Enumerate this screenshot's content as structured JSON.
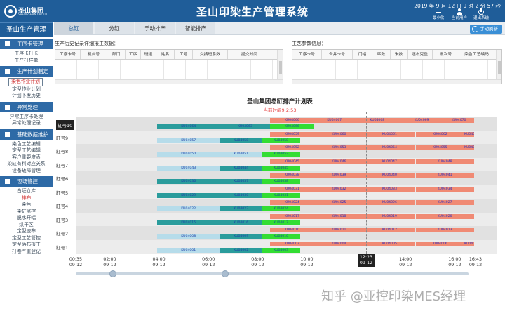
{
  "header": {
    "logo_text": "圣山集团",
    "logo_sub": "SHENGSHAN GROUP",
    "title": "圣山印染生产管理系统",
    "clock": "2019 年 9 月 12 日 9 时 2 分 57 秒",
    "buttons": [
      {
        "label": "最小化",
        "icon": "minimize-icon"
      },
      {
        "label": "当前用户",
        "icon": "user-icon"
      },
      {
        "label": "退出系统",
        "icon": "power-icon"
      }
    ]
  },
  "sidebar": {
    "title": "圣山生产管理",
    "sections": [
      {
        "label": "工序卡管理",
        "items": [
          {
            "label": "工序卡打卡"
          },
          {
            "label": "生产打样单"
          }
        ]
      },
      {
        "label": "生产计划制定",
        "items": [
          {
            "label": "染色作业计划",
            "state": "selected"
          },
          {
            "label": "定型作业计划"
          },
          {
            "label": "计划下发历史"
          }
        ]
      },
      {
        "label": "异常处理",
        "items": [
          {
            "label": "异常工序卡处理"
          },
          {
            "label": "异常处理记录"
          }
        ]
      },
      {
        "label": "基础数据维护",
        "items": [
          {
            "label": "染色工艺编辑"
          },
          {
            "label": "定型工艺编辑"
          },
          {
            "label": "客户重要度表"
          },
          {
            "label": "染缸有料对应关系"
          },
          {
            "label": "设备故障管理"
          }
        ]
      },
      {
        "label": "现场管控",
        "items": [
          {
            "label": "白坯仓库"
          },
          {
            "label": "排布",
            "state": "active"
          },
          {
            "label": "染色"
          },
          {
            "label": "染缸监控"
          },
          {
            "label": "脱水开幅"
          },
          {
            "label": "烘干区"
          },
          {
            "label": "定型速布"
          },
          {
            "label": "定型工艺管控"
          },
          {
            "label": "定型落布报工"
          },
          {
            "label": "打卷严重登记"
          }
        ]
      }
    ]
  },
  "tabs": {
    "items": [
      {
        "label": "总缸",
        "active": true
      },
      {
        "label": "分缸"
      },
      {
        "label": "手动排产"
      },
      {
        "label": "智能排产"
      }
    ],
    "refresh_label": "手动刷新"
  },
  "history_panel": {
    "label": "生产历史记录详细报工数据：",
    "columns": [
      "工序卡号",
      "机台号",
      "部门",
      "工序",
      "班组",
      "姓名",
      "工号",
      "交接班系数",
      "提交时间"
    ]
  },
  "process_panel": {
    "label": "工艺参数信息：",
    "columns": [
      "工序卡号",
      "合并卡号",
      "门幅",
      "匹数",
      "米数",
      "坯布克重",
      "批次号",
      "染色工艺编码"
    ]
  },
  "gantt": {
    "title": "圣山集团总缸排产计划表",
    "current_time": "当前时间9:2:53",
    "now_label": [
      "12:23",
      "09-12"
    ],
    "axis": [
      {
        "time": "00:35",
        "date": "09-12"
      },
      {
        "time": "02:00",
        "date": "09-12"
      },
      {
        "time": "04:00",
        "date": "09-12"
      },
      {
        "time": "06:00",
        "date": "09-12"
      },
      {
        "time": "08:00",
        "date": "09-12"
      },
      {
        "time": "10:00",
        "date": "09-12"
      },
      {
        "time": "14:00",
        "date": "09-12"
      },
      {
        "time": "16:00",
        "date": "09-12"
      },
      {
        "time": "16:43",
        "date": "09-12"
      }
    ],
    "rows": [
      {
        "label": "缸号10",
        "highlight": true,
        "bars": [
          {
            "id": "KU04064",
            "color": "teal",
            "start": 0.203,
            "end": 0.361
          },
          {
            "id": "KU04063",
            "color": "teal",
            "start": 0.361,
            "end": 0.486
          },
          {
            "id": "KU04066",
            "color": "green",
            "start": 0.486,
            "end": 0.596
          },
          {
            "id": "KU04066",
            "color": "salmon",
            "start": 0.486,
            "end": 0.596
          },
          {
            "id": "KU04067",
            "color": "salmon",
            "start": 0.596,
            "end": 0.698
          },
          {
            "id": "KU04068",
            "color": "salmon",
            "start": 0.698,
            "end": 0.81
          },
          {
            "id": "KU04069",
            "color": "salmon",
            "start": 0.81,
            "end": 0.92
          },
          {
            "id": "KU04070",
            "color": "salmon",
            "start": 0.92,
            "end": 0.996
          }
        ]
      },
      {
        "label": "缸号9",
        "bars": [
          {
            "id": "KU04057",
            "color": "lightblue",
            "start": 0.203,
            "end": 0.361
          },
          {
            "id": "KU04058",
            "color": "teal",
            "start": 0.361,
            "end": 0.466
          },
          {
            "id": "KU04058",
            "color": "green",
            "start": 0.466,
            "end": 0.561
          },
          {
            "id": "KU04059",
            "color": "salmon",
            "start": 0.486,
            "end": 0.596
          },
          {
            "id": "KU04060",
            "color": "salmon",
            "start": 0.596,
            "end": 0.72
          },
          {
            "id": "KU04061",
            "color": "salmon",
            "start": 0.72,
            "end": 0.85
          },
          {
            "id": "KU04062",
            "color": "salmon",
            "start": 0.85,
            "end": 0.972
          },
          {
            "id": "KU04063",
            "color": "salmon",
            "start": 0.972,
            "end": 0.996
          }
        ]
      },
      {
        "label": "缸号8",
        "bars": [
          {
            "id": "KU04050",
            "color": "lightblue",
            "start": 0.203,
            "end": 0.361
          },
          {
            "id": "KU04051",
            "color": "lightblue",
            "start": 0.361,
            "end": 0.466
          },
          {
            "id": "KU04052",
            "color": "green",
            "start": 0.466,
            "end": 0.561
          },
          {
            "id": "KU04052",
            "color": "salmon",
            "start": 0.486,
            "end": 0.596
          },
          {
            "id": "KU04053",
            "color": "salmon",
            "start": 0.596,
            "end": 0.72
          },
          {
            "id": "KU04054",
            "color": "salmon",
            "start": 0.72,
            "end": 0.85
          },
          {
            "id": "KU04055",
            "color": "salmon",
            "start": 0.85,
            "end": 0.972
          },
          {
            "id": "KU04056",
            "color": "salmon",
            "start": 0.972,
            "end": 0.996
          }
        ]
      },
      {
        "label": "缸号7",
        "bars": [
          {
            "id": "KU04043",
            "color": "lightblue",
            "start": 0.203,
            "end": 0.361
          },
          {
            "id": "KU04044",
            "color": "teal",
            "start": 0.361,
            "end": 0.466
          },
          {
            "id": "KU04045",
            "color": "green",
            "start": 0.466,
            "end": 0.561
          },
          {
            "id": "KU04045",
            "color": "salmon",
            "start": 0.486,
            "end": 0.596
          },
          {
            "id": "KU04046",
            "color": "salmon",
            "start": 0.596,
            "end": 0.72
          },
          {
            "id": "KU04047",
            "color": "salmon",
            "start": 0.72,
            "end": 0.85
          },
          {
            "id": "KU04048",
            "color": "salmon",
            "start": 0.85,
            "end": 0.996
          }
        ]
      },
      {
        "label": "缸号6",
        "bars": [
          {
            "id": "KU04036",
            "color": "teal",
            "start": 0.203,
            "end": 0.361
          },
          {
            "id": "KU04037",
            "color": "teal",
            "start": 0.361,
            "end": 0.466
          },
          {
            "id": "KU04038",
            "color": "green",
            "start": 0.466,
            "end": 0.561
          },
          {
            "id": "KU04038",
            "color": "salmon",
            "start": 0.486,
            "end": 0.596
          },
          {
            "id": "KU04039",
            "color": "salmon",
            "start": 0.596,
            "end": 0.72
          },
          {
            "id": "KU04040",
            "color": "salmon",
            "start": 0.72,
            "end": 0.85
          },
          {
            "id": "KU04041",
            "color": "salmon",
            "start": 0.85,
            "end": 0.996
          }
        ]
      },
      {
        "label": "缸号5",
        "bars": [
          {
            "id": "KU04029",
            "color": "teal",
            "start": 0.203,
            "end": 0.361
          },
          {
            "id": "KU04030",
            "color": "teal",
            "start": 0.361,
            "end": 0.466
          },
          {
            "id": "KU04031",
            "color": "green",
            "start": 0.466,
            "end": 0.561
          },
          {
            "id": "KU04031",
            "color": "salmon",
            "start": 0.486,
            "end": 0.596
          },
          {
            "id": "KU04032",
            "color": "salmon",
            "start": 0.596,
            "end": 0.72
          },
          {
            "id": "KU04033",
            "color": "salmon",
            "start": 0.72,
            "end": 0.85
          },
          {
            "id": "KU04034",
            "color": "salmon",
            "start": 0.85,
            "end": 0.996
          }
        ]
      },
      {
        "label": "缸号4",
        "bars": [
          {
            "id": "KU04022",
            "color": "lightblue",
            "start": 0.203,
            "end": 0.361
          },
          {
            "id": "KU04023",
            "color": "teal",
            "start": 0.361,
            "end": 0.466
          },
          {
            "id": "KU04024",
            "color": "green",
            "start": 0.466,
            "end": 0.561
          },
          {
            "id": "KU04024",
            "color": "salmon",
            "start": 0.486,
            "end": 0.596
          },
          {
            "id": "KU04025",
            "color": "salmon",
            "start": 0.596,
            "end": 0.72
          },
          {
            "id": "KU04026",
            "color": "salmon",
            "start": 0.72,
            "end": 0.85
          },
          {
            "id": "KU04027",
            "color": "salmon",
            "start": 0.85,
            "end": 0.996
          }
        ]
      },
      {
        "label": "缸号3",
        "bars": [
          {
            "id": "KU04015",
            "color": "teal",
            "start": 0.203,
            "end": 0.361
          },
          {
            "id": "KU04016",
            "color": "teal",
            "start": 0.361,
            "end": 0.466
          },
          {
            "id": "KU04017",
            "color": "green",
            "start": 0.466,
            "end": 0.561
          },
          {
            "id": "KU04017",
            "color": "salmon",
            "start": 0.486,
            "end": 0.596
          },
          {
            "id": "KU04018",
            "color": "salmon",
            "start": 0.596,
            "end": 0.72
          },
          {
            "id": "KU04019",
            "color": "salmon",
            "start": 0.72,
            "end": 0.85
          },
          {
            "id": "KU04020",
            "color": "salmon",
            "start": 0.85,
            "end": 0.996
          }
        ]
      },
      {
        "label": "缸号2",
        "bars": [
          {
            "id": "KU04008",
            "color": "lightblue",
            "start": 0.203,
            "end": 0.361
          },
          {
            "id": "KU04009",
            "color": "teal",
            "start": 0.361,
            "end": 0.466
          },
          {
            "id": "KU04010",
            "color": "green",
            "start": 0.466,
            "end": 0.561
          },
          {
            "id": "KU04010",
            "color": "salmon",
            "start": 0.486,
            "end": 0.596
          },
          {
            "id": "KU04011",
            "color": "salmon",
            "start": 0.596,
            "end": 0.72
          },
          {
            "id": "KU04012",
            "color": "salmon",
            "start": 0.72,
            "end": 0.85
          },
          {
            "id": "KU04013",
            "color": "salmon",
            "start": 0.85,
            "end": 0.996
          }
        ]
      },
      {
        "label": "缸号1",
        "bars": [
          {
            "id": "KU04001",
            "color": "lightblue",
            "start": 0.203,
            "end": 0.361
          },
          {
            "id": "KU04002",
            "color": "teal",
            "start": 0.361,
            "end": 0.466
          },
          {
            "id": "KU04003",
            "color": "green",
            "start": 0.466,
            "end": 0.561
          },
          {
            "id": "KU04003",
            "color": "salmon",
            "start": 0.486,
            "end": 0.596
          },
          {
            "id": "KU04004",
            "color": "salmon",
            "start": 0.596,
            "end": 0.72
          },
          {
            "id": "KU04005",
            "color": "salmon",
            "start": 0.72,
            "end": 0.85
          },
          {
            "id": "KU04006",
            "color": "salmon",
            "start": 0.85,
            "end": 0.972
          },
          {
            "id": "KU04007",
            "color": "salmon",
            "start": 0.972,
            "end": 0.996
          }
        ]
      }
    ],
    "colors": {
      "teal": "#2a9c9c",
      "lightblue": "#b6dcea",
      "green": "#33dd33",
      "salmon": "#f08a74"
    }
  },
  "watermark": "知乎 @亚控印染MES经理"
}
